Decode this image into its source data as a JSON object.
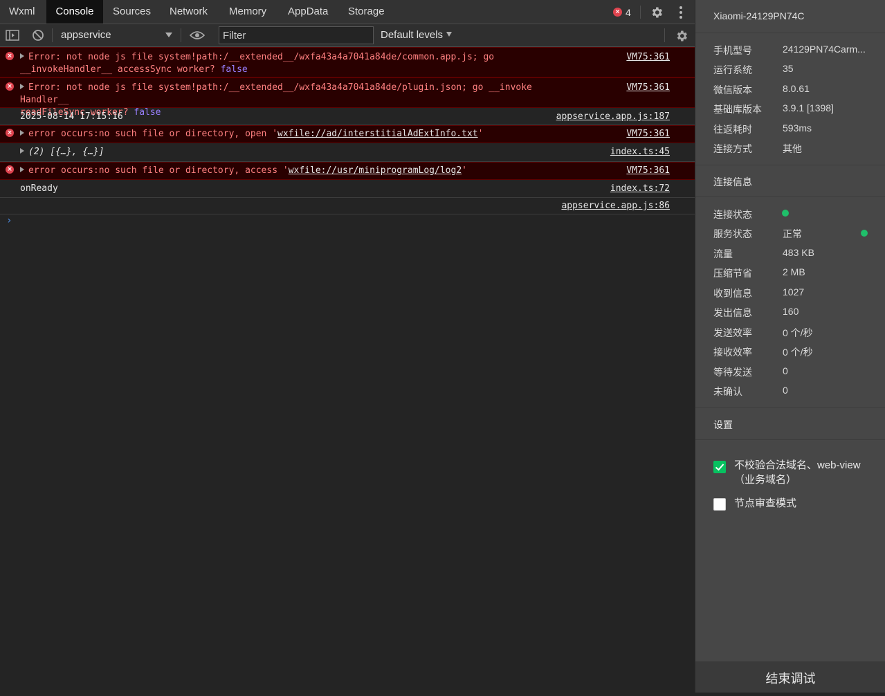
{
  "tabs": [
    "Wxml",
    "Console",
    "Sources",
    "Network",
    "Memory",
    "AppData",
    "Storage"
  ],
  "error_count": "4",
  "toolbar": {
    "context": "appservice",
    "filter_placeholder": "Filter",
    "levels": "Default levels"
  },
  "console": {
    "rows": [
      {
        "type": "error",
        "line1": "Error: not node js file system!path:/__extended__/wxfa43a4a7041a84de/common.app.js; go",
        "line2": "__invokeHandler__ accessSync worker? ",
        "kw": "false",
        "source": "VM75:361"
      },
      {
        "type": "error",
        "line1": "Error: not node js file system!path:/__extended__/wxfa43a4a7041a84de/plugin.json; go __invokeHandler__",
        "line2": "readFileSync worker? ",
        "kw": "false",
        "source": "VM75:361"
      },
      {
        "type": "log",
        "text": "2025-08-14 17:15:16",
        "source": "appservice.app.js:187"
      },
      {
        "type": "error",
        "prefix": "error occurs:no such file or directory, open '",
        "link": "wxfile://ad/interstitialAdExtInfo.txt",
        "suffix": "'",
        "source": "VM75:361"
      },
      {
        "type": "log",
        "text": "(2) [{…}, {…}]",
        "source": "index.ts:45"
      },
      {
        "type": "error",
        "prefix": "error occurs:no such file or directory, access '",
        "link": "wxfile://usr/miniprogramLog/log2",
        "suffix": "'",
        "source": "VM75:361"
      },
      {
        "type": "log",
        "text": "onReady",
        "source": "index.ts:72"
      },
      {
        "type": "log",
        "text": "",
        "source": "appservice.app.js:86"
      }
    ],
    "prompt": "›"
  },
  "panel": {
    "device": "Xiaomi-24129PN74C",
    "info": [
      {
        "label": "手机型号",
        "value": "24129PN74Carm..."
      },
      {
        "label": "运行系统",
        "value": "35"
      },
      {
        "label": "微信版本",
        "value": "8.0.61"
      },
      {
        "label": "基础库版本",
        "value": "3.9.1 [1398]"
      },
      {
        "label": "往返耗时",
        "value": "593ms"
      },
      {
        "label": "连接方式",
        "value": "其他"
      }
    ],
    "conn_title": "连接信息",
    "conn": [
      {
        "label": "连接状态",
        "value": ""
      },
      {
        "label": "服务状态",
        "value": "正常"
      },
      {
        "label": "流量",
        "value": "483 KB"
      },
      {
        "label": "压缩节省",
        "value": "2 MB"
      },
      {
        "label": "收到信息",
        "value": "1027"
      },
      {
        "label": "发出信息",
        "value": "160"
      },
      {
        "label": "发送效率",
        "value": "0 个/秒"
      },
      {
        "label": "接收效率",
        "value": "0 个/秒"
      },
      {
        "label": "等待发送",
        "value": "0"
      },
      {
        "label": "未确认",
        "value": "0"
      }
    ],
    "status_color": "#1fbf6a",
    "settings_title": "设置",
    "settings": [
      {
        "label": "不校验合法域名、web-view（业务域名）",
        "checked": true
      },
      {
        "label": "节点审查模式",
        "checked": false
      }
    ],
    "end_button": "结束调试"
  }
}
